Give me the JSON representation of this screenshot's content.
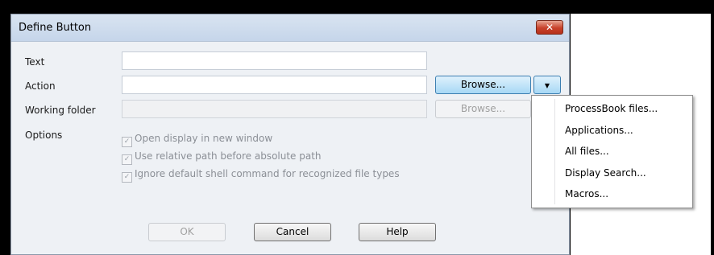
{
  "dialog": {
    "title": "Define Button",
    "close_icon": "close-icon",
    "labels": {
      "text": "Text",
      "action": "Action",
      "working_folder": "Working folder",
      "options": "Options"
    },
    "fields": {
      "text_value": "",
      "action_value": "",
      "working_folder_value": ""
    },
    "browse_action_label": "Browse...",
    "browse_working_label": "Browse...",
    "dropdown_icon": "chevron-down-icon",
    "options": [
      {
        "label": "Open display in new window",
        "checked": true
      },
      {
        "label": "Use relative path before absolute path",
        "checked": true
      },
      {
        "label": "Ignore default shell command for recognized file types",
        "checked": true
      }
    ],
    "buttons": {
      "ok": "OK",
      "cancel": "Cancel",
      "help": "Help"
    }
  },
  "menu": {
    "items": [
      "ProcessBook files...",
      "Applications...",
      "All files...",
      "Display Search...",
      "Macros..."
    ]
  }
}
